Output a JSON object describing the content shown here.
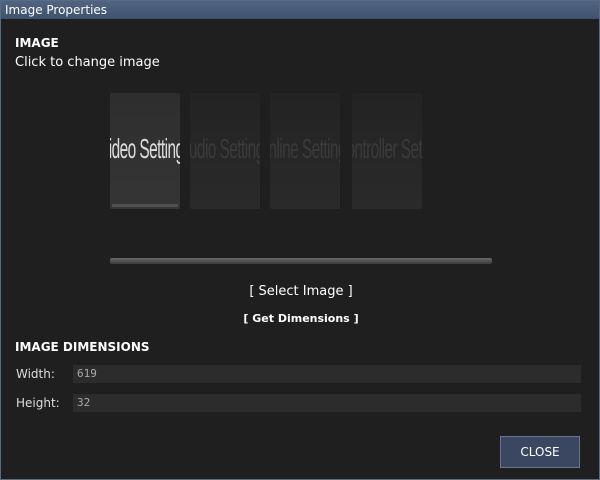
{
  "dialog": {
    "title": "Image Properties",
    "image_section_title": "IMAGE",
    "image_hint": "Click to change image",
    "preview_tiles": [
      {
        "label": "Video Settings",
        "active": true
      },
      {
        "label": "Audio Settings",
        "active": false
      },
      {
        "label": "Online Settings",
        "active": false
      },
      {
        "label": "Controller Setup",
        "active": false
      }
    ],
    "select_image_label": "[ Select Image ]",
    "get_dimensions_label": "[ Get Dimensions ]",
    "dimensions_section_title": "IMAGE DIMENSIONS",
    "width_label": "Width:",
    "width_value": "619",
    "height_label": "Height:",
    "height_value": "32",
    "close_label": "CLOSE"
  }
}
